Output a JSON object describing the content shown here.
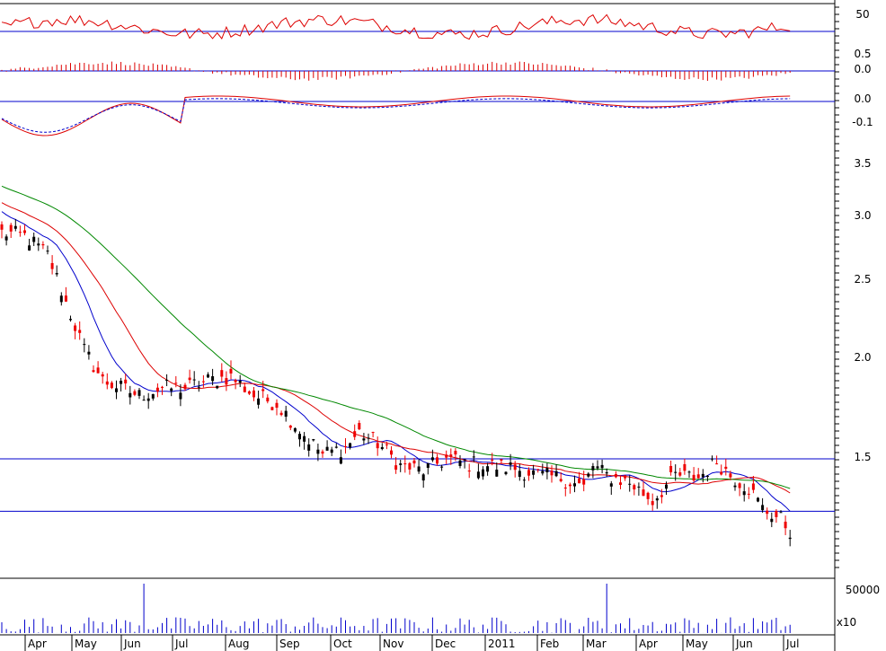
{
  "chart_data": {
    "type": "line",
    "title": "",
    "colors": {
      "up": "#000000",
      "down": "#ee0000",
      "ma_short": "#0000cc",
      "ma_mid": "#dd0000",
      "ma_long": "#008800",
      "ref_line": "#0000cc",
      "volume": "#0000cc",
      "osc": "#dd0000"
    },
    "x_labels": [
      "Apr",
      "May",
      "Jun",
      "Jul",
      "Aug",
      "Sep",
      "Oct",
      "Nov",
      "Dec",
      "2011",
      "Feb",
      "Mar",
      "Apr",
      "May",
      "Jun",
      "Jul"
    ],
    "panels": [
      {
        "name": "rsi",
        "yticks": [
          "50"
        ],
        "ref_lines": [
          50,
          100
        ]
      },
      {
        "name": "histogram",
        "yticks": [
          "0.5",
          "0.0"
        ]
      },
      {
        "name": "macd",
        "yticks": [
          "0.0",
          "-0.1"
        ]
      },
      {
        "name": "price",
        "yticks": [
          "3.5",
          "3.0",
          "2.5",
          "2.0",
          "1.5"
        ],
        "ylim": [
          1.0,
          3.7
        ],
        "ref_lines": [
          1.5,
          1.29
        ]
      },
      {
        "name": "volume",
        "yticks": [
          "50000"
        ],
        "multiplier_label": "x10"
      }
    ],
    "price_anchors": [
      [
        0,
        2.88
      ],
      [
        5,
        2.85
      ],
      [
        10,
        2.7
      ],
      [
        14,
        2.35
      ],
      [
        18,
        2.05
      ],
      [
        22,
        1.88
      ],
      [
        25,
        1.85
      ],
      [
        30,
        1.8
      ],
      [
        35,
        1.84
      ],
      [
        40,
        1.84
      ],
      [
        45,
        1.88
      ],
      [
        50,
        1.9
      ],
      [
        55,
        1.8
      ],
      [
        60,
        1.76
      ],
      [
        65,
        1.63
      ],
      [
        70,
        1.52
      ],
      [
        75,
        1.55
      ],
      [
        78,
        1.62
      ],
      [
        82,
        1.57
      ],
      [
        87,
        1.47
      ],
      [
        92,
        1.45
      ],
      [
        97,
        1.5
      ],
      [
        102,
        1.48
      ],
      [
        107,
        1.47
      ],
      [
        112,
        1.46
      ],
      [
        117,
        1.43
      ],
      [
        122,
        1.42
      ],
      [
        127,
        1.38
      ],
      [
        129,
        1.47
      ],
      [
        132,
        1.43
      ],
      [
        137,
        1.4
      ],
      [
        142,
        1.33
      ],
      [
        147,
        1.43
      ],
      [
        152,
        1.42
      ],
      [
        156,
        1.49
      ],
      [
        159,
        1.43
      ],
      [
        163,
        1.38
      ],
      [
        166,
        1.3
      ],
      [
        170,
        1.26
      ],
      [
        172,
        1.22
      ]
    ],
    "volume_note": "volume bars with peaks near Jun and Mar",
    "oscillator_note": "RSI around 50 line, histogram near 0, MACD with signal line"
  }
}
